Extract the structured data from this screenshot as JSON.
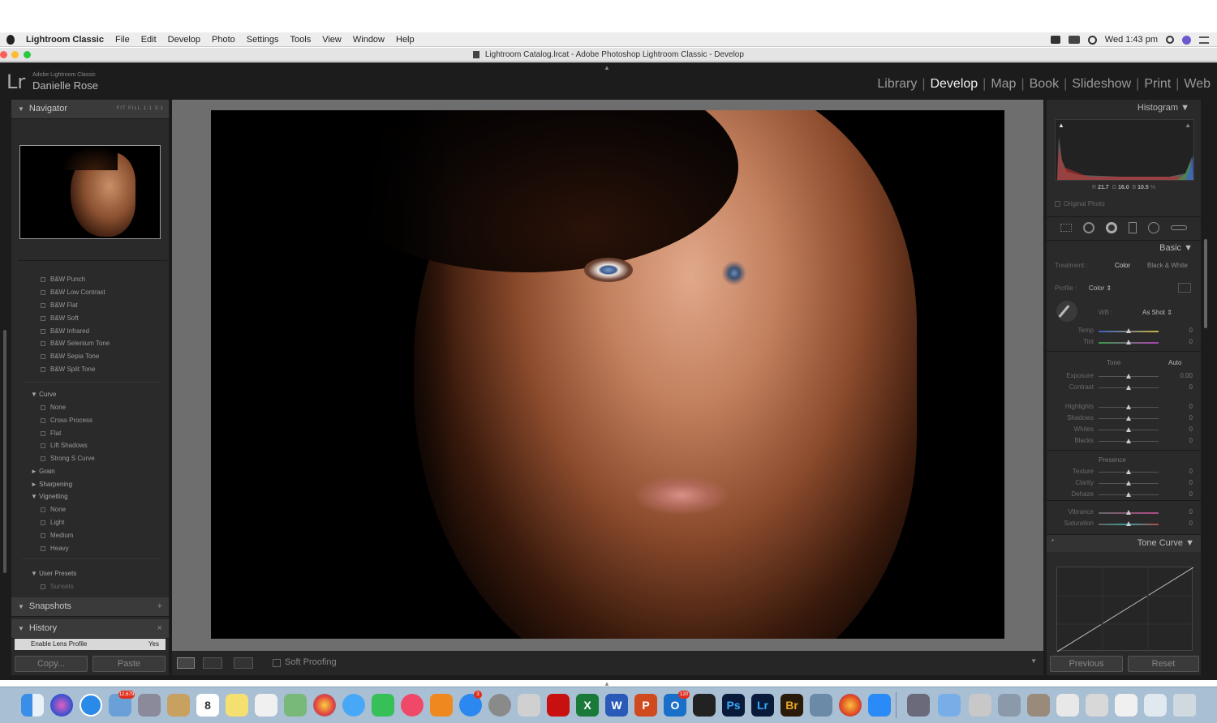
{
  "menubar": {
    "app_name": "Lightroom Classic",
    "items": [
      "File",
      "Edit",
      "Develop",
      "Photo",
      "Settings",
      "Tools",
      "View",
      "Window",
      "Help"
    ],
    "clock": "Wed 1:43 pm"
  },
  "window_title": "Lightroom Catalog.lrcat - Adobe Photoshop Lightroom Classic - Develop",
  "identity": {
    "small": "Adobe Lightroom Classic",
    "name": "Danielle Rose",
    "logo": "Lr"
  },
  "modules": [
    "Library",
    "Develop",
    "Map",
    "Book",
    "Slideshow",
    "Print",
    "Web"
  ],
  "active_module": "Develop",
  "left": {
    "navigator": {
      "title": "Navigator",
      "zoom_options": [
        "FIT",
        "FILL",
        "1:1",
        "3:1"
      ]
    },
    "presets_bw": [
      "B&W Punch",
      "B&W Low Contrast",
      "B&W Flat",
      "B&W Soft",
      "B&W Infrared",
      "B&W Selenium Tone",
      "B&W Sepia Tone",
      "B&W Split Tone"
    ],
    "curve_folder": "Curve",
    "curve_presets": [
      "None",
      "Cross Process",
      "Flat",
      "Lift Shadows",
      "Strong S Curve"
    ],
    "grain": "Grain",
    "sharpening": "Sharpening",
    "vignetting": "Vignetting",
    "vignetting_presets": [
      "None",
      "Light",
      "Medium",
      "Heavy"
    ],
    "user_presets": "User Presets",
    "user_preset_items": [
      "Sunsets"
    ],
    "snapshots": "Snapshots",
    "history": "History",
    "history_item": {
      "label": "Enable Lens Profile",
      "value": "Yes"
    },
    "copy": "Copy...",
    "paste": "Paste"
  },
  "toolbar": {
    "soft_proofing": "Soft Proofing"
  },
  "right": {
    "histogram_title": "Histogram",
    "rgb": {
      "r_label": "R",
      "r": "21.7",
      "g_label": "G",
      "g": "16.0",
      "b_label": "B",
      "b": "10.5",
      "unit": "%"
    },
    "original_photo": "Original Photo",
    "basic_title": "Basic",
    "treatment_label": "Treatment :",
    "treatment_color": "Color",
    "treatment_bw": "Black & White",
    "profile_label": "Profile :",
    "profile_value": "Color",
    "wb_label": "WB :",
    "wb_value": "As Shot",
    "temp": {
      "label": "Temp",
      "value": "0"
    },
    "tint": {
      "label": "Tint",
      "value": "0"
    },
    "tone_label": "Tone",
    "auto": "Auto",
    "exposure": {
      "label": "Exposure",
      "value": "0.00"
    },
    "contrast": {
      "label": "Contrast",
      "value": "0"
    },
    "highlights": {
      "label": "Highlights",
      "value": "0"
    },
    "shadows": {
      "label": "Shadows",
      "value": "0"
    },
    "whites": {
      "label": "Whites",
      "value": "0"
    },
    "blacks": {
      "label": "Blacks",
      "value": "0"
    },
    "presence_label": "Presence",
    "texture": {
      "label": "Texture",
      "value": "0"
    },
    "clarity": {
      "label": "Clarity",
      "value": "0"
    },
    "dehaze": {
      "label": "Dehaze",
      "value": "0"
    },
    "vibrance": {
      "label": "Vibrance",
      "value": "0"
    },
    "saturation": {
      "label": "Saturation",
      "value": "0"
    },
    "tone_curve_title": "Tone Curve",
    "previous": "Previous",
    "reset": "Reset"
  },
  "dock": {
    "mail_badge": "12,679",
    "calendar_day": "8",
    "outlook_badge": "120",
    "appstore_badge": "3"
  },
  "colors": {
    "accent": "#f0f0f0",
    "panel": "#2a2a2a",
    "chrome": "#1c1c1c"
  }
}
